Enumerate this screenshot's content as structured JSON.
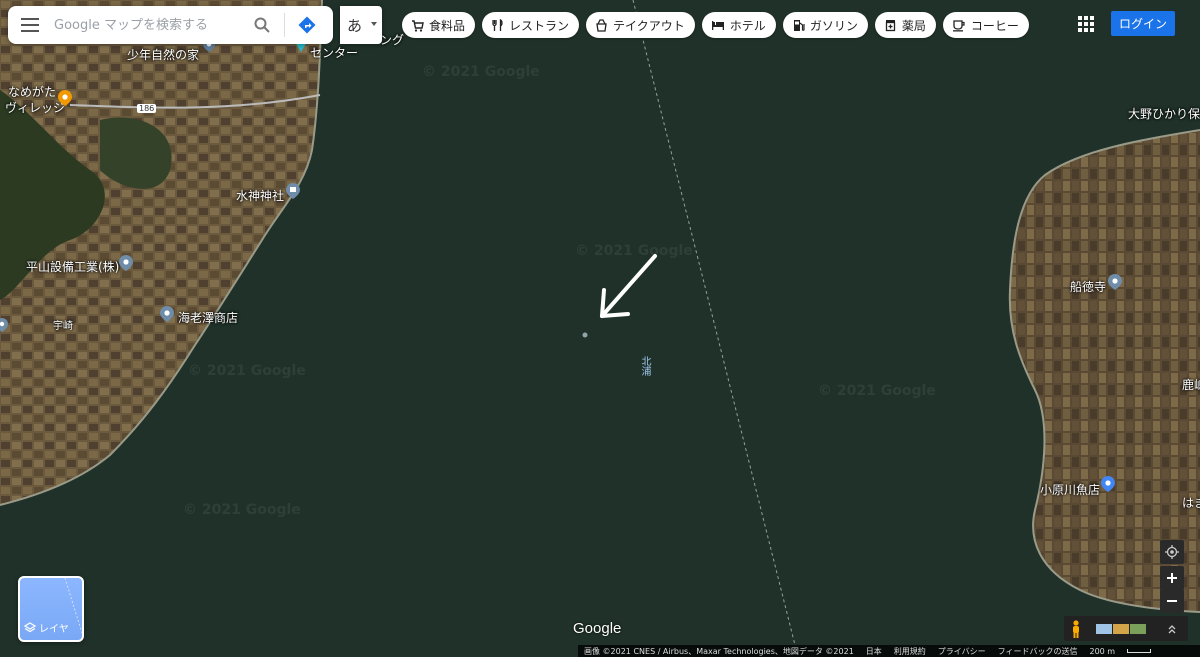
{
  "search": {
    "placeholder": "Google マップを検索する"
  },
  "ime": {
    "label": "あ"
  },
  "chips": [
    {
      "label": "食料品",
      "icon": "cart-icon"
    },
    {
      "label": "レストラン",
      "icon": "fork-knife-icon"
    },
    {
      "label": "テイクアウト",
      "icon": "takeout-icon"
    },
    {
      "label": "ホテル",
      "icon": "bed-icon"
    },
    {
      "label": "ガソリン",
      "icon": "gas-pump-icon"
    },
    {
      "label": "薬局",
      "icon": "pharmacy-icon"
    },
    {
      "label": "コーヒー",
      "icon": "coffee-cup-icon"
    }
  ],
  "login": "ログイン",
  "places": {
    "ring": "ング",
    "center": "センター",
    "shonen": "少年自然の家",
    "namegata": "なめがた",
    "village": "ヴィレッジ",
    "road186": "186",
    "suijin": "水神神社",
    "hirayama": "平山設備工業(株)",
    "uzaki": "宇崎",
    "ebisawa": "海老澤商店",
    "ohno": "大野ひかり保",
    "funatoku": "船徳寺",
    "kashima": "鹿嶋",
    "obara": "小原川魚店",
    "hama": "はま"
  },
  "lake_name": "北浦",
  "watermark": "© 2021 Google",
  "layer_label": "レイヤ",
  "google_logo": "Google",
  "footer": {
    "imagery": "画像 ©2021 CNES / Airbus、Maxar Technologies、地図データ ©2021",
    "country": "日本",
    "terms": "利用規約",
    "privacy": "プライバシー",
    "feedback": "フィードバックの送信",
    "scale": "200 m"
  }
}
